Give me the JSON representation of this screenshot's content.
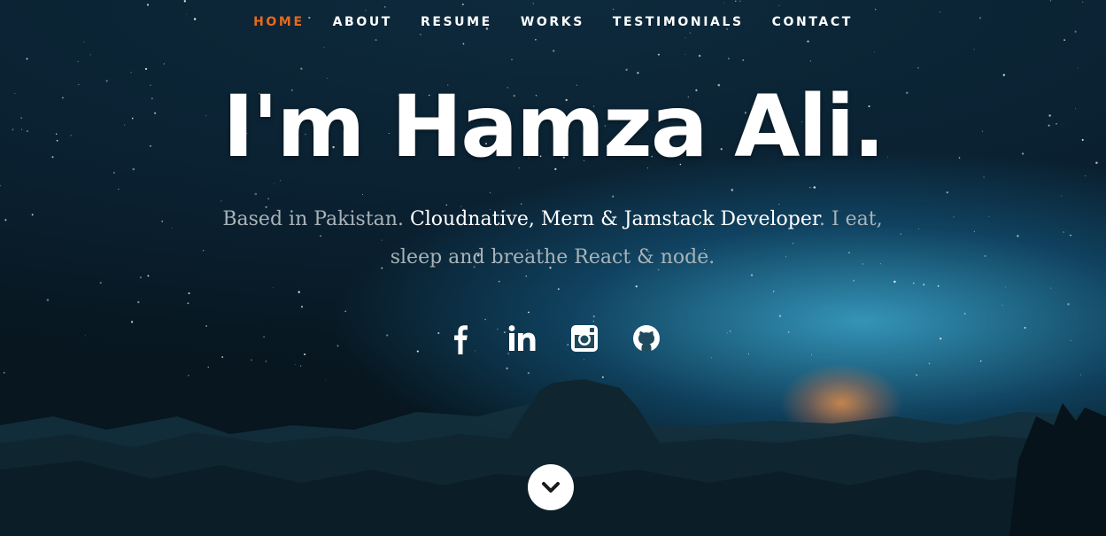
{
  "nav": {
    "items": [
      {
        "label": "HOME",
        "active": true
      },
      {
        "label": "ABOUT",
        "active": false
      },
      {
        "label": "RESUME",
        "active": false
      },
      {
        "label": "WORKS",
        "active": false
      },
      {
        "label": "TESTIMONIALS",
        "active": false
      },
      {
        "label": "CONTACT",
        "active": false
      }
    ]
  },
  "hero": {
    "headline": "I'm Hamza Ali.",
    "tagline_part1": "Based in Pakistan. ",
    "tagline_highlight": "Cloudnative, Mern & Jamstack Developer",
    "tagline_part2": ". I eat, sleep and breathe React & node."
  },
  "social": [
    "facebook-icon",
    "linkedin-icon",
    "instagram-icon",
    "github-icon"
  ],
  "colors": {
    "accent": "#e8691b",
    "text": "#ffffff",
    "muted_text": "#a9b3b7"
  }
}
